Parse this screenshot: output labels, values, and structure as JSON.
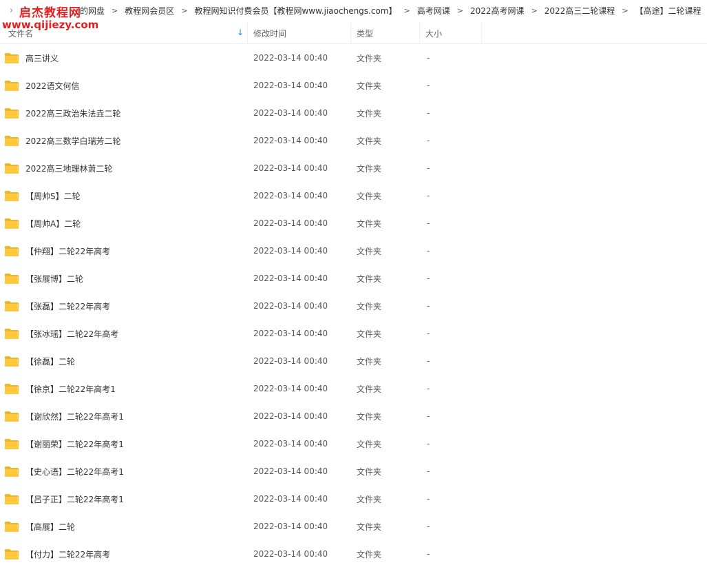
{
  "watermark": {
    "title": "启杰教程网",
    "url": "www.qijiezy.com"
  },
  "breadcrumb": {
    "lead": "›",
    "items": [
      "的网盘",
      "教程网会员区",
      "教程网知识付费会员【教程网www.jiaochengs.com】",
      "高考网课",
      "2022高考网课",
      "2022高三二轮课程",
      "【高途】二轮课程"
    ],
    "separator": ">"
  },
  "columns": {
    "name": "文件名",
    "mtime": "修改时间",
    "type": "类型",
    "size": "大小",
    "sort_indicator": "↓"
  },
  "colors": {
    "folder": "#ffc83d",
    "folder_tab": "#f0b428",
    "accent": "#2b7fe6",
    "watermark": "#e02020"
  },
  "icons": {
    "folder": "folder-icon",
    "sort": "arrow-down-icon",
    "separator": "chevron-right-icon"
  },
  "files": [
    {
      "name": "高三讲义",
      "mtime": "2022-03-14 00:40",
      "type": "文件夹",
      "size": "-"
    },
    {
      "name": "2022语文何信",
      "mtime": "2022-03-14 00:40",
      "type": "文件夹",
      "size": "-"
    },
    {
      "name": "2022高三政治朱法垚二轮",
      "mtime": "2022-03-14 00:40",
      "type": "文件夹",
      "size": "-"
    },
    {
      "name": "2022高三数学白瑞芳二轮",
      "mtime": "2022-03-14 00:40",
      "type": "文件夹",
      "size": "-"
    },
    {
      "name": "2022高三地理林萧二轮",
      "mtime": "2022-03-14 00:40",
      "type": "文件夹",
      "size": "-"
    },
    {
      "name": "【周帅S】二轮",
      "mtime": "2022-03-14 00:40",
      "type": "文件夹",
      "size": "-"
    },
    {
      "name": "【周帅A】二轮",
      "mtime": "2022-03-14 00:40",
      "type": "文件夹",
      "size": "-"
    },
    {
      "name": "【仲翔】二轮22年高考",
      "mtime": "2022-03-14 00:40",
      "type": "文件夹",
      "size": "-"
    },
    {
      "name": "【张展博】二轮",
      "mtime": "2022-03-14 00:40",
      "type": "文件夹",
      "size": "-"
    },
    {
      "name": "【张磊】二轮22年高考",
      "mtime": "2022-03-14 00:40",
      "type": "文件夹",
      "size": "-"
    },
    {
      "name": "【张冰瑶】二轮22年高考",
      "mtime": "2022-03-14 00:40",
      "type": "文件夹",
      "size": "-"
    },
    {
      "name": "【徐磊】二轮",
      "mtime": "2022-03-14 00:40",
      "type": "文件夹",
      "size": "-"
    },
    {
      "name": "【徐京】二轮22年高考1",
      "mtime": "2022-03-14 00:40",
      "type": "文件夹",
      "size": "-"
    },
    {
      "name": "【谢欣然】二轮22年高考1",
      "mtime": "2022-03-14 00:40",
      "type": "文件夹",
      "size": "-"
    },
    {
      "name": "【谢丽荣】二轮22年高考1",
      "mtime": "2022-03-14 00:40",
      "type": "文件夹",
      "size": "-"
    },
    {
      "name": "【史心语】二轮22年高考1",
      "mtime": "2022-03-14 00:40",
      "type": "文件夹",
      "size": "-"
    },
    {
      "name": "【吕子正】二轮22年高考1",
      "mtime": "2022-03-14 00:40",
      "type": "文件夹",
      "size": "-"
    },
    {
      "name": "【高展】二轮",
      "mtime": "2022-03-14 00:40",
      "type": "文件夹",
      "size": "-"
    },
    {
      "name": "【付力】二轮22年高考",
      "mtime": "2022-03-14 00:40",
      "type": "文件夹",
      "size": "-"
    }
  ]
}
